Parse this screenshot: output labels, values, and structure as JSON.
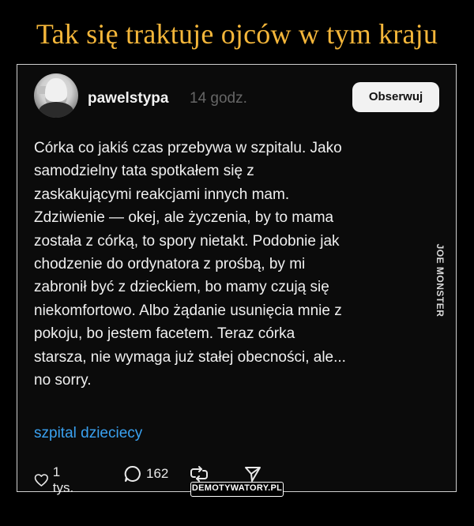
{
  "header": {
    "title": "Tak się traktuje ojców w tym kraju"
  },
  "post": {
    "username": "pawelstypa",
    "time": "14 godz.",
    "follow_label": "Obserwuj",
    "text_lines": [
      "Córka co jakiś czas przebywa w szpitalu. Jako",
      "samodzielny tata spotkałem się z",
      "zaskakującymi reakcjami innych mam.",
      "Zdziwienie — okej, ale życzenia, by to mama",
      "została z córką, to spory nietakt. Podobnie jak",
      "chodzenie do ordynatora z prośbą, by mi",
      "zabronił być z dzieckiem, bo mamy czują się",
      "niekomfortowo. Albo żądanie usunięcia mnie z",
      "pokoju, bo jestem facetem. Teraz córka",
      "starsza, nie wymaga już stałej obecności, ale...",
      "no sorry."
    ],
    "hashtag": "szpital dzieciecy",
    "likes": "1 tys.",
    "comments": "162"
  },
  "watermark": "JOE MONSTER",
  "footer_badge": "DEMOTYWATORY.PL",
  "icons": [
    "avatar",
    "heart-icon",
    "comment-icon",
    "repost-icon",
    "share-icon"
  ],
  "colors": {
    "title": "#f4b63a",
    "hashtag": "#3aa1f0",
    "background": "#000000"
  }
}
